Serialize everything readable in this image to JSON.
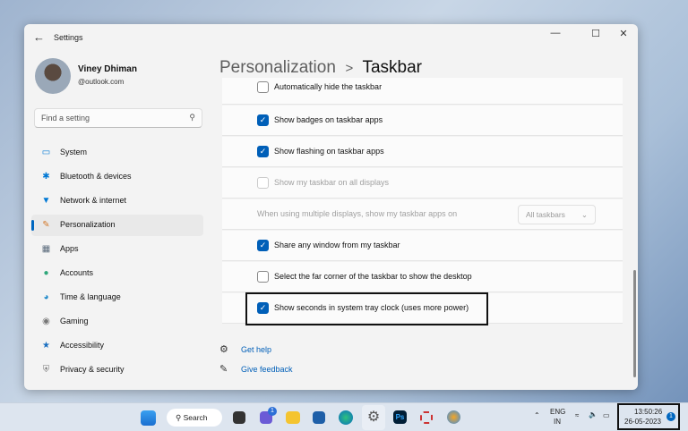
{
  "window": {
    "title": "Settings",
    "controls": [
      "minimize",
      "maximize",
      "close"
    ]
  },
  "user": {
    "name": "Viney Dhiman",
    "email": "@outlook.com"
  },
  "search": {
    "placeholder": "Find a setting"
  },
  "sidebar": {
    "items": [
      {
        "label": "System",
        "icon": "monitor-icon",
        "color": "#0078d4"
      },
      {
        "label": "Bluetooth & devices",
        "icon": "bluetooth-icon",
        "color": "#0078d4"
      },
      {
        "label": "Network & internet",
        "icon": "wifi-icon",
        "color": "#0078d4"
      },
      {
        "label": "Personalization",
        "icon": "brush-icon",
        "color": "#d47a2c",
        "selected": true
      },
      {
        "label": "Apps",
        "icon": "apps-icon",
        "color": "#5b6b7c"
      },
      {
        "label": "Accounts",
        "icon": "person-icon",
        "color": "#2fa77a"
      },
      {
        "label": "Time & language",
        "icon": "globe-icon",
        "color": "#1e88c9"
      },
      {
        "label": "Gaming",
        "icon": "controller-icon",
        "color": "#777"
      },
      {
        "label": "Accessibility",
        "icon": "accessibility-icon",
        "color": "#1a6fc0"
      },
      {
        "label": "Privacy & security",
        "icon": "shield-icon",
        "color": "#777"
      }
    ]
  },
  "breadcrumb": {
    "parent": "Personalization",
    "separator": ">",
    "current": "Taskbar"
  },
  "settings": [
    {
      "label": "Automatically hide the taskbar",
      "checked": false
    },
    {
      "label": "Show badges on taskbar apps",
      "checked": true
    },
    {
      "label": "Show flashing on taskbar apps",
      "checked": true
    },
    {
      "label": "Show my taskbar on all displays",
      "checked": false,
      "disabled": true
    },
    {
      "label": "When using multiple displays, show my taskbar apps on",
      "dropdown": "All taskbars",
      "disabled": true
    },
    {
      "label": "Share any window from my taskbar",
      "checked": true
    },
    {
      "label": "Select the far corner of the taskbar to show the desktop",
      "checked": false
    },
    {
      "label": "Show seconds in system tray clock (uses more power)",
      "checked": true
    }
  ],
  "links": {
    "help": "Get help",
    "feedback": "Give feedback"
  },
  "taskbar": {
    "search": "Search",
    "chat_badge": "1",
    "lang": "ENG",
    "region": "IN",
    "time": "13:50:26",
    "date": "26-05-2023",
    "notif": "1"
  }
}
